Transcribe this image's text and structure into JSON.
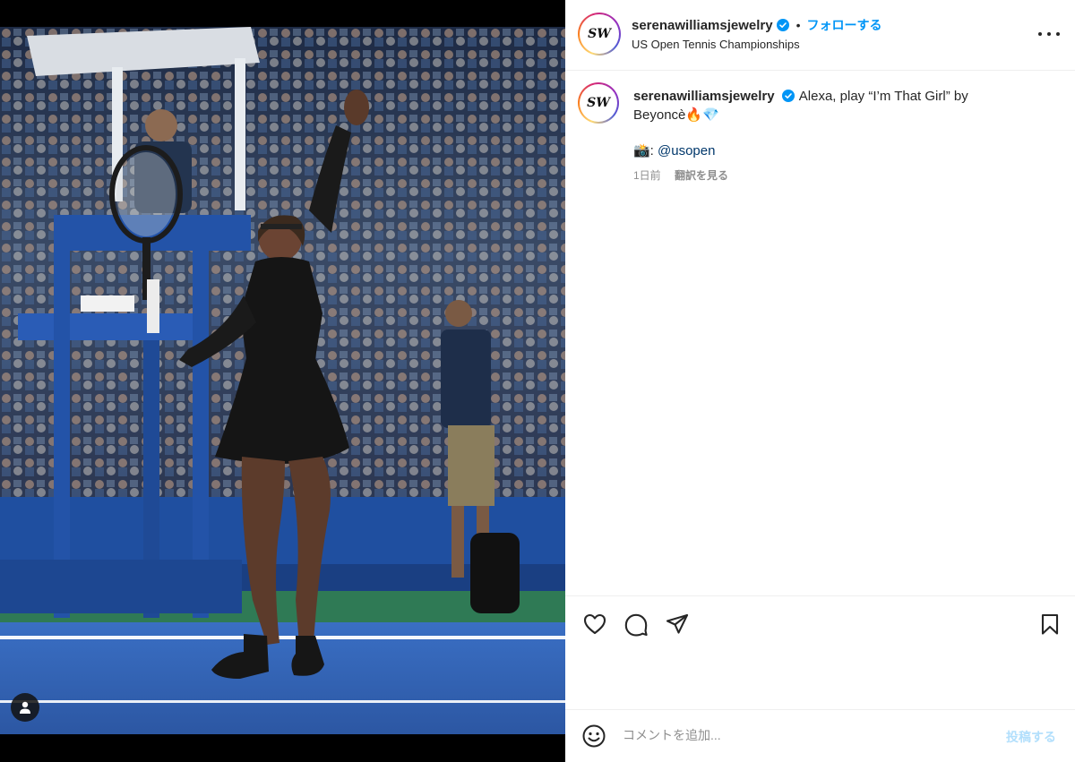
{
  "account": {
    "username": "serenawilliamsjewelry",
    "avatar_text": "SW",
    "verified_icon": "verified-badge-icon",
    "follow_label": "フォローする",
    "location": "US Open Tennis Championships",
    "separator": "•"
  },
  "caption": {
    "text_line": "Alexa, play “I’m That Girl” by Beyoncè🔥💎",
    "credit_prefix": "📸: ",
    "credit_mention": "@usopen",
    "time_ago": "1日前",
    "translate_label": "翻訳を見る"
  },
  "actions": {
    "icons": [
      "heart-icon",
      "comment-icon",
      "share-icon",
      "bookmark-icon"
    ]
  },
  "comment": {
    "emoji_icon": "emoji-icon",
    "placeholder": "コメントを追加...",
    "post_label": "投稿する"
  },
  "media": {
    "tag_icon": "user-tag-icon"
  },
  "colors": {
    "accent": "#0095f6",
    "post_disabled": "#b2dffc",
    "mention": "#00376b",
    "court_blue": "#2f62b8",
    "court_green": "#2f7a55"
  }
}
